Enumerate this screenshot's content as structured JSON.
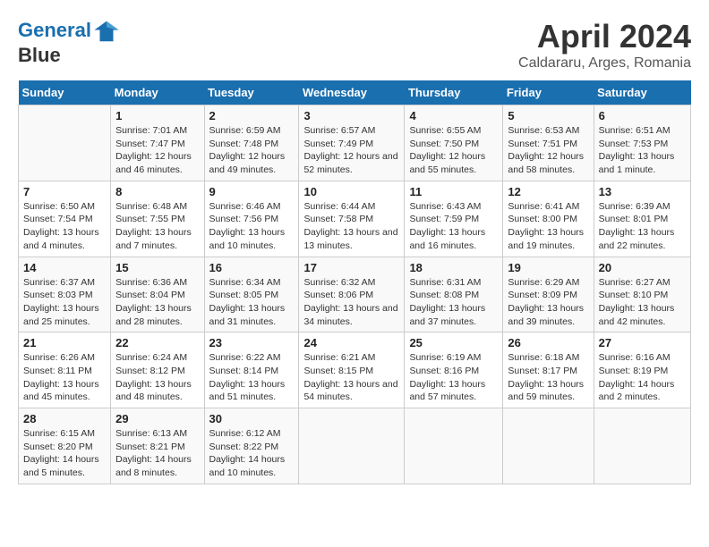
{
  "header": {
    "logo_line1": "General",
    "logo_line2": "Blue",
    "title": "April 2024",
    "subtitle": "Caldararu, Arges, Romania"
  },
  "weekdays": [
    "Sunday",
    "Monday",
    "Tuesday",
    "Wednesday",
    "Thursday",
    "Friday",
    "Saturday"
  ],
  "weeks": [
    [
      {
        "num": "",
        "sunrise": "",
        "sunset": "",
        "daylight": ""
      },
      {
        "num": "1",
        "sunrise": "Sunrise: 7:01 AM",
        "sunset": "Sunset: 7:47 PM",
        "daylight": "Daylight: 12 hours and 46 minutes."
      },
      {
        "num": "2",
        "sunrise": "Sunrise: 6:59 AM",
        "sunset": "Sunset: 7:48 PM",
        "daylight": "Daylight: 12 hours and 49 minutes."
      },
      {
        "num": "3",
        "sunrise": "Sunrise: 6:57 AM",
        "sunset": "Sunset: 7:49 PM",
        "daylight": "Daylight: 12 hours and 52 minutes."
      },
      {
        "num": "4",
        "sunrise": "Sunrise: 6:55 AM",
        "sunset": "Sunset: 7:50 PM",
        "daylight": "Daylight: 12 hours and 55 minutes."
      },
      {
        "num": "5",
        "sunrise": "Sunrise: 6:53 AM",
        "sunset": "Sunset: 7:51 PM",
        "daylight": "Daylight: 12 hours and 58 minutes."
      },
      {
        "num": "6",
        "sunrise": "Sunrise: 6:51 AM",
        "sunset": "Sunset: 7:53 PM",
        "daylight": "Daylight: 13 hours and 1 minute."
      }
    ],
    [
      {
        "num": "7",
        "sunrise": "Sunrise: 6:50 AM",
        "sunset": "Sunset: 7:54 PM",
        "daylight": "Daylight: 13 hours and 4 minutes."
      },
      {
        "num": "8",
        "sunrise": "Sunrise: 6:48 AM",
        "sunset": "Sunset: 7:55 PM",
        "daylight": "Daylight: 13 hours and 7 minutes."
      },
      {
        "num": "9",
        "sunrise": "Sunrise: 6:46 AM",
        "sunset": "Sunset: 7:56 PM",
        "daylight": "Daylight: 13 hours and 10 minutes."
      },
      {
        "num": "10",
        "sunrise": "Sunrise: 6:44 AM",
        "sunset": "Sunset: 7:58 PM",
        "daylight": "Daylight: 13 hours and 13 minutes."
      },
      {
        "num": "11",
        "sunrise": "Sunrise: 6:43 AM",
        "sunset": "Sunset: 7:59 PM",
        "daylight": "Daylight: 13 hours and 16 minutes."
      },
      {
        "num": "12",
        "sunrise": "Sunrise: 6:41 AM",
        "sunset": "Sunset: 8:00 PM",
        "daylight": "Daylight: 13 hours and 19 minutes."
      },
      {
        "num": "13",
        "sunrise": "Sunrise: 6:39 AM",
        "sunset": "Sunset: 8:01 PM",
        "daylight": "Daylight: 13 hours and 22 minutes."
      }
    ],
    [
      {
        "num": "14",
        "sunrise": "Sunrise: 6:37 AM",
        "sunset": "Sunset: 8:03 PM",
        "daylight": "Daylight: 13 hours and 25 minutes."
      },
      {
        "num": "15",
        "sunrise": "Sunrise: 6:36 AM",
        "sunset": "Sunset: 8:04 PM",
        "daylight": "Daylight: 13 hours and 28 minutes."
      },
      {
        "num": "16",
        "sunrise": "Sunrise: 6:34 AM",
        "sunset": "Sunset: 8:05 PM",
        "daylight": "Daylight: 13 hours and 31 minutes."
      },
      {
        "num": "17",
        "sunrise": "Sunrise: 6:32 AM",
        "sunset": "Sunset: 8:06 PM",
        "daylight": "Daylight: 13 hours and 34 minutes."
      },
      {
        "num": "18",
        "sunrise": "Sunrise: 6:31 AM",
        "sunset": "Sunset: 8:08 PM",
        "daylight": "Daylight: 13 hours and 37 minutes."
      },
      {
        "num": "19",
        "sunrise": "Sunrise: 6:29 AM",
        "sunset": "Sunset: 8:09 PM",
        "daylight": "Daylight: 13 hours and 39 minutes."
      },
      {
        "num": "20",
        "sunrise": "Sunrise: 6:27 AM",
        "sunset": "Sunset: 8:10 PM",
        "daylight": "Daylight: 13 hours and 42 minutes."
      }
    ],
    [
      {
        "num": "21",
        "sunrise": "Sunrise: 6:26 AM",
        "sunset": "Sunset: 8:11 PM",
        "daylight": "Daylight: 13 hours and 45 minutes."
      },
      {
        "num": "22",
        "sunrise": "Sunrise: 6:24 AM",
        "sunset": "Sunset: 8:12 PM",
        "daylight": "Daylight: 13 hours and 48 minutes."
      },
      {
        "num": "23",
        "sunrise": "Sunrise: 6:22 AM",
        "sunset": "Sunset: 8:14 PM",
        "daylight": "Daylight: 13 hours and 51 minutes."
      },
      {
        "num": "24",
        "sunrise": "Sunrise: 6:21 AM",
        "sunset": "Sunset: 8:15 PM",
        "daylight": "Daylight: 13 hours and 54 minutes."
      },
      {
        "num": "25",
        "sunrise": "Sunrise: 6:19 AM",
        "sunset": "Sunset: 8:16 PM",
        "daylight": "Daylight: 13 hours and 57 minutes."
      },
      {
        "num": "26",
        "sunrise": "Sunrise: 6:18 AM",
        "sunset": "Sunset: 8:17 PM",
        "daylight": "Daylight: 13 hours and 59 minutes."
      },
      {
        "num": "27",
        "sunrise": "Sunrise: 6:16 AM",
        "sunset": "Sunset: 8:19 PM",
        "daylight": "Daylight: 14 hours and 2 minutes."
      }
    ],
    [
      {
        "num": "28",
        "sunrise": "Sunrise: 6:15 AM",
        "sunset": "Sunset: 8:20 PM",
        "daylight": "Daylight: 14 hours and 5 minutes."
      },
      {
        "num": "29",
        "sunrise": "Sunrise: 6:13 AM",
        "sunset": "Sunset: 8:21 PM",
        "daylight": "Daylight: 14 hours and 8 minutes."
      },
      {
        "num": "30",
        "sunrise": "Sunrise: 6:12 AM",
        "sunset": "Sunset: 8:22 PM",
        "daylight": "Daylight: 14 hours and 10 minutes."
      },
      {
        "num": "",
        "sunrise": "",
        "sunset": "",
        "daylight": ""
      },
      {
        "num": "",
        "sunrise": "",
        "sunset": "",
        "daylight": ""
      },
      {
        "num": "",
        "sunrise": "",
        "sunset": "",
        "daylight": ""
      },
      {
        "num": "",
        "sunrise": "",
        "sunset": "",
        "daylight": ""
      }
    ]
  ]
}
